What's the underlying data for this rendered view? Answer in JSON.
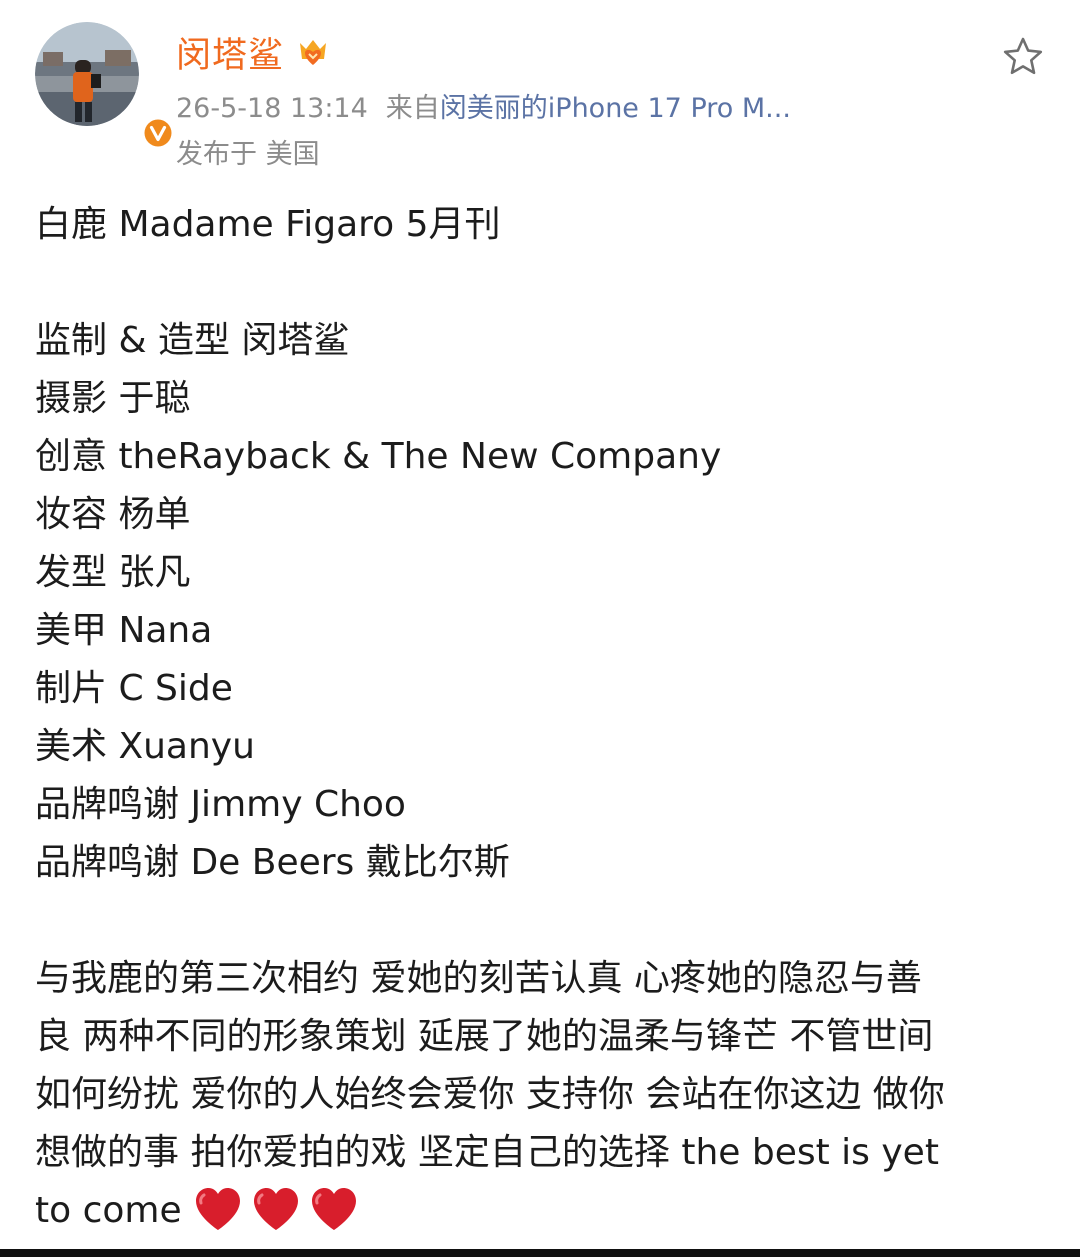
{
  "user": {
    "name": "闵塔鲨",
    "avatar_icon": "avatar-photo",
    "badge_icon": "verified-v-icon",
    "badge_color": "#f08a1c",
    "name_color": "#f06a1f",
    "crown_icon": "crown-badge-icon"
  },
  "meta": {
    "timestamp": "26-5-18 13:14",
    "source_prefix": "来自",
    "source_device": "闵美丽的iPhone 17 Pro M...",
    "location": "发布于 美国"
  },
  "actions": {
    "favorite_icon": "star-outline-icon"
  },
  "post": {
    "title": "白鹿  Madame Figaro 5月刊",
    "credits": [
      "监制 & 造型 闵塔鲨",
      "摄影 于聪",
      "创意 theRayback & The New Company",
      "妆容 杨单",
      "发型 张凡",
      "美甲 Nana",
      "制片 C Side",
      "美术 Xuanyu",
      "品牌鸣谢 Jimmy Choo",
      "品牌鸣谢 De Beers 戴比尔斯"
    ],
    "message_lines": [
      "与我鹿的第三次相约 爱她的刻苦认真 心疼她的隐忍与善",
      "良 两种不同的形象策划 延展了她的温柔与锋芒 不管世间",
      "如何纷扰 爱你的人始终会爱你 支持你 会站在你这边 做你",
      "想做的事 拍你爱拍的戏 坚定自己的选择 the best is yet"
    ],
    "message_end": "to come",
    "emoji": [
      "heart-emoji",
      "heart-emoji",
      "heart-emoji"
    ]
  }
}
